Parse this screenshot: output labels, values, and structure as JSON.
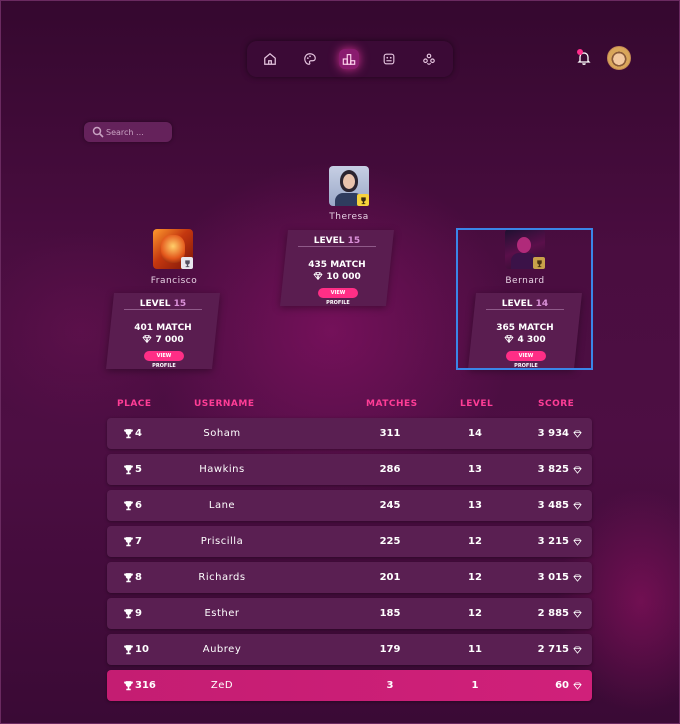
{
  "nav": {
    "icons": [
      "home-icon",
      "palette-icon",
      "leaderboard-icon",
      "gamepad-icon",
      "community-icon"
    ],
    "active": "leaderboard-icon"
  },
  "search": {
    "placeholder": "Search ..."
  },
  "podium": [
    {
      "rank": 2,
      "name": "Francisco",
      "level_label": "LEVEL",
      "level": "15",
      "match": "401 MATCH",
      "score": "7 000",
      "button": "VIEW PROFILE"
    },
    {
      "rank": 1,
      "name": "Theresa",
      "level_label": "LEVEL",
      "level": "15",
      "match": "435 MATCH",
      "score": "10 000",
      "button": "VIEW PROFILE"
    },
    {
      "rank": 3,
      "name": "Bernard",
      "level_label": "LEVEL",
      "level": "14",
      "match": "365 MATCH",
      "score": "4 300",
      "button": "VIEW PROFILE"
    }
  ],
  "table": {
    "headers": {
      "place": "PLACE",
      "username": "USERNAME",
      "matches": "MATCHES",
      "level": "LEVEL",
      "score": "SCORE"
    },
    "rows": [
      {
        "place": "4",
        "username": "Soham",
        "matches": "311",
        "level": "14",
        "score": "3 934"
      },
      {
        "place": "5",
        "username": "Hawkins",
        "matches": "286",
        "level": "13",
        "score": "3 825"
      },
      {
        "place": "6",
        "username": "Lane",
        "matches": "245",
        "level": "13",
        "score": "3 485"
      },
      {
        "place": "7",
        "username": "Priscilla",
        "matches": "225",
        "level": "12",
        "score": "3 215"
      },
      {
        "place": "8",
        "username": "Richards",
        "matches": "201",
        "level": "12",
        "score": "3 015"
      },
      {
        "place": "9",
        "username": "Esther",
        "matches": "185",
        "level": "12",
        "score": "2 885"
      },
      {
        "place": "10",
        "username": "Aubrey",
        "matches": "179",
        "level": "11",
        "score": "2 715"
      }
    ],
    "current_user": {
      "place": "316",
      "username": "ZeD",
      "matches": "3",
      "level": "1",
      "score": "60"
    }
  },
  "colors": {
    "accent": "#ff2e86",
    "row_bg": "#5a1f52",
    "highlight_row": "#c41d72",
    "level_num": "#d990d8"
  }
}
